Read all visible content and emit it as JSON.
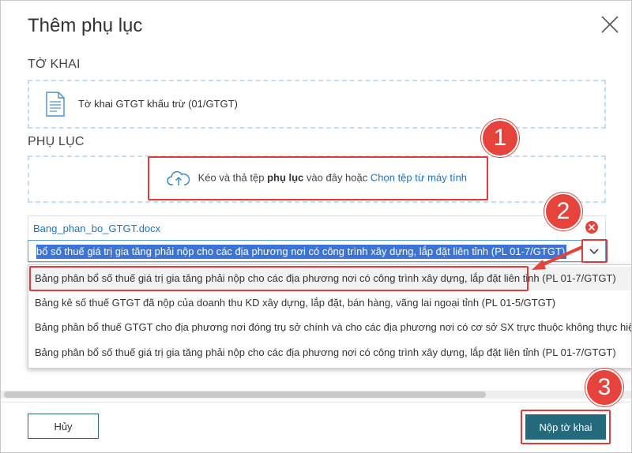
{
  "dialog": {
    "title": "Thêm phụ lục",
    "close_label": "Đóng"
  },
  "to_khai": {
    "section_label": "TỜ KHAI",
    "document_name": "Tờ khai GTGT khấu trừ (01/GTGT)"
  },
  "phu_luc": {
    "section_label": "PHỤ LỤC",
    "upload_text_before": "Kéo và thả tệp",
    "upload_text_bold": "phụ lục",
    "upload_text_after": "vào đây hoặc",
    "upload_link": "Chọn tệp từ máy tính"
  },
  "file": {
    "name": "Bang_phan_bo_GTGT.docx",
    "selected_value": "bổ số thuế giá trị gia tăng phải nộp cho các địa phương nơi có công trình xây dựng, lắp đặt liên tỉnh (PL 01-7/GTGT)"
  },
  "dropdown": {
    "options": [
      "Bảng phân bổ số thuế giá trị gia tăng phải nộp cho các địa phương nơi có công trình xây dựng, lắp đặt liên tỉnh (PL 01-7/GTGT)",
      "Bảng kê số thuế GTGT đã nộp của doanh thu KD xây dựng, lắp đặt, bán hàng, vãng lai ngoại tỉnh (PL 01-5/GTGT)",
      "Bảng phân bổ thuế GTGT cho địa phương nơi đóng trụ sở chính và cho các địa phương nơi có cơ sở SX trực thuộc không thực hiện hạch toán kế toán",
      "Bảng phân bổ số thuế giá trị gia tăng phải nộp cho các địa phương nơi có công trình xây dựng, lắp đặt liên tỉnh (PL 01-7/GTGT)"
    ],
    "selected_index": 0
  },
  "badges": [
    "1",
    "2",
    "3"
  ],
  "footer": {
    "cancel_label": "Hủy",
    "submit_label": "Nộp tờ khai"
  },
  "colors": {
    "primary": "#256a7c",
    "link": "#1a73c8",
    "highlight": "#3b73d6",
    "annotation_red": "#e5433b",
    "dashed_border": "#c9dcec"
  }
}
